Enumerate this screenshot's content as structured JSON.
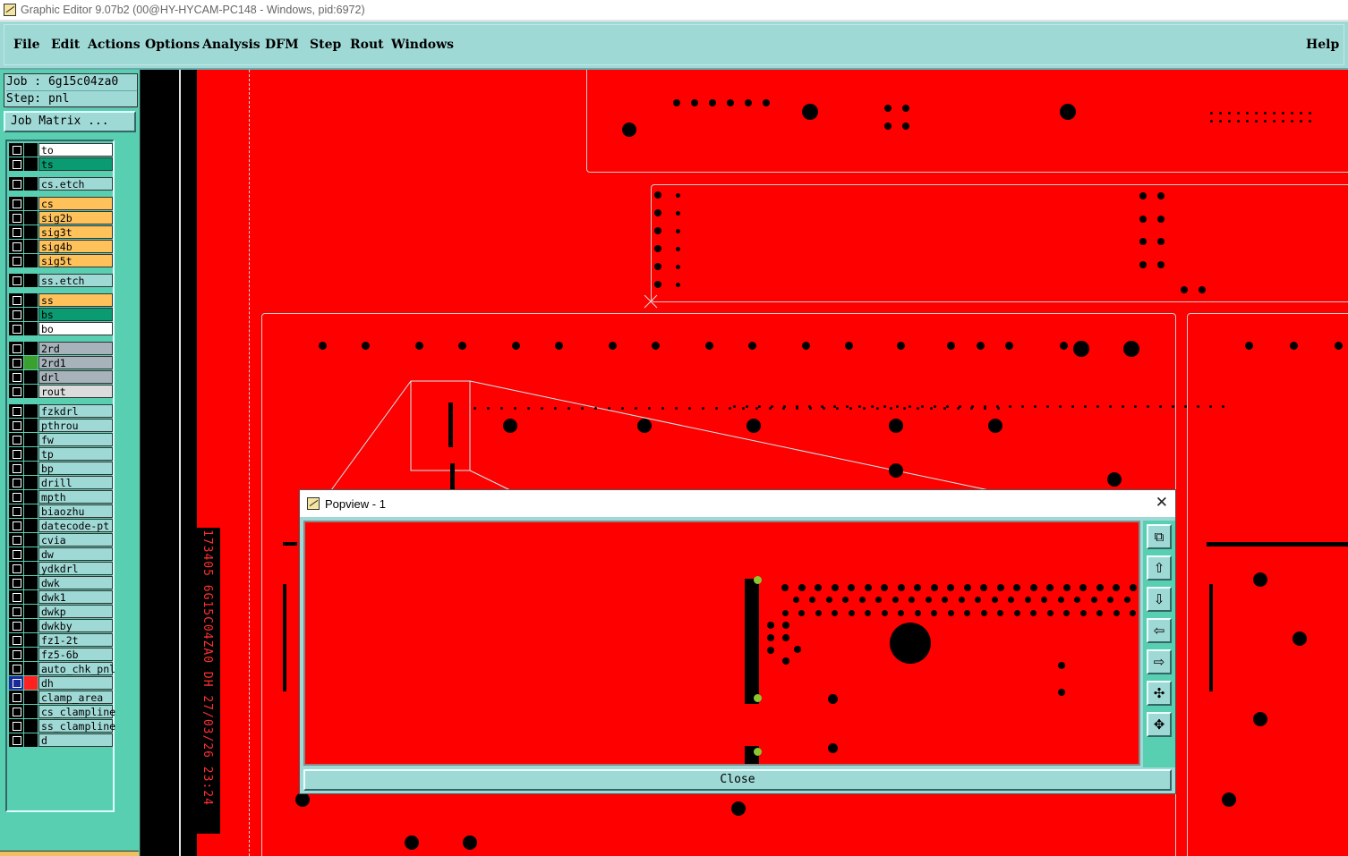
{
  "window": {
    "title": "Graphic Editor 9.07b2 (00@HY-HYCAM-PC148 - Windows, pid:6972)"
  },
  "menu": {
    "items": [
      {
        "label": "File"
      },
      {
        "label": "Edit"
      },
      {
        "label": "Actions"
      },
      {
        "label": "Options"
      },
      {
        "label": "Analysis"
      },
      {
        "label": "DFM"
      },
      {
        "label": "Step"
      },
      {
        "label": "Rout"
      },
      {
        "label": "Windows"
      }
    ],
    "help": "Help"
  },
  "job": {
    "job_line": "Job : 6g15c04za0",
    "step_line": "Step: pnl",
    "matrix_button": "Job Matrix ..."
  },
  "colors": {
    "panel": "#59cfb1",
    "menubar": "#9fd9d6",
    "board": "#ff0000"
  },
  "layers": [
    {
      "name": "to",
      "color": "#ffffff",
      "swatch": "#000000"
    },
    {
      "name": "ts",
      "color": "#0a9b73",
      "swatch": "#000000"
    },
    {
      "name": "cs.etch",
      "color": "#9fd9d6",
      "swatch": "#000000"
    },
    {
      "name": "cs",
      "color": "#ffc25a",
      "swatch": "#000000"
    },
    {
      "name": "sig2b",
      "color": "#ffc25a",
      "swatch": "#000000"
    },
    {
      "name": "sig3t",
      "color": "#ffc25a",
      "swatch": "#000000"
    },
    {
      "name": "sig4b",
      "color": "#ffc25a",
      "swatch": "#000000"
    },
    {
      "name": "sig5t",
      "color": "#ffc25a",
      "swatch": "#000000"
    },
    {
      "name": "ss.etch",
      "color": "#9fd9d6",
      "swatch": "#000000"
    },
    {
      "name": "ss",
      "color": "#ffc25a",
      "swatch": "#000000"
    },
    {
      "name": "bs",
      "color": "#0a9b73",
      "swatch": "#000000"
    },
    {
      "name": "bo",
      "color": "#ffffff",
      "swatch": "#000000"
    },
    {
      "name": "2rd",
      "color": "#a7b2bb",
      "swatch": "#000000"
    },
    {
      "name": "2rd1",
      "color": "#a7b2bb",
      "swatch": "#3aa030"
    },
    {
      "name": "drl",
      "color": "#a7b2bb",
      "swatch": "#000000"
    },
    {
      "name": "rout",
      "color": "#dcdcdc",
      "swatch": "#000000"
    },
    {
      "name": "fzkdrl",
      "color": "#9fd9d6",
      "swatch": "#000000"
    },
    {
      "name": "pthrou",
      "color": "#9fd9d6",
      "swatch": "#000000"
    },
    {
      "name": "fw",
      "color": "#9fd9d6",
      "swatch": "#000000"
    },
    {
      "name": "tp",
      "color": "#9fd9d6",
      "swatch": "#000000"
    },
    {
      "name": "bp",
      "color": "#9fd9d6",
      "swatch": "#000000"
    },
    {
      "name": "drill",
      "color": "#9fd9d6",
      "swatch": "#000000"
    },
    {
      "name": "mpth",
      "color": "#9fd9d6",
      "swatch": "#000000"
    },
    {
      "name": "biaozhu",
      "color": "#9fd9d6",
      "swatch": "#000000"
    },
    {
      "name": "datecode-pt",
      "color": "#9fd9d6",
      "swatch": "#000000"
    },
    {
      "name": "cvia",
      "color": "#9fd9d6",
      "swatch": "#000000"
    },
    {
      "name": "dw",
      "color": "#9fd9d6",
      "swatch": "#000000"
    },
    {
      "name": "ydkdrl",
      "color": "#9fd9d6",
      "swatch": "#000000"
    },
    {
      "name": "dwk",
      "color": "#9fd9d6",
      "swatch": "#000000"
    },
    {
      "name": "dwk1",
      "color": "#9fd9d6",
      "swatch": "#000000"
    },
    {
      "name": "dwkp",
      "color": "#9fd9d6",
      "swatch": "#000000"
    },
    {
      "name": "dwkby",
      "color": "#9fd9d6",
      "swatch": "#000000"
    },
    {
      "name": "fz1-2t",
      "color": "#9fd9d6",
      "swatch": "#000000"
    },
    {
      "name": "fz5-6b",
      "color": "#9fd9d6",
      "swatch": "#000000"
    },
    {
      "name": "auto_chk_pnl",
      "color": "#9fd9d6",
      "swatch": "#000000"
    },
    {
      "name": "dh",
      "color": "#9fd9d6",
      "swatch": "#ff2020",
      "active": true
    },
    {
      "name": "clamp_area",
      "color": "#9fd9d6",
      "swatch": "#000000"
    },
    {
      "name": "cs_clampline",
      "color": "#9fd9d6",
      "swatch": "#000000"
    },
    {
      "name": "ss_clampline",
      "color": "#9fd9d6",
      "swatch": "#000000"
    },
    {
      "name": "d",
      "color": "#9fd9d6",
      "swatch": "#000000"
    }
  ],
  "canvas": {
    "stamp_text": "173405 6G15C04ZA0 DH 27/03/26 23:24"
  },
  "popview": {
    "title": "Popview - 1",
    "close_label": "Close",
    "side_buttons": [
      "zoom-window-icon",
      "pan-up-icon",
      "pan-down-icon",
      "pan-left-icon",
      "pan-right-icon",
      "zoom-out-icon",
      "zoom-in-icon"
    ]
  }
}
